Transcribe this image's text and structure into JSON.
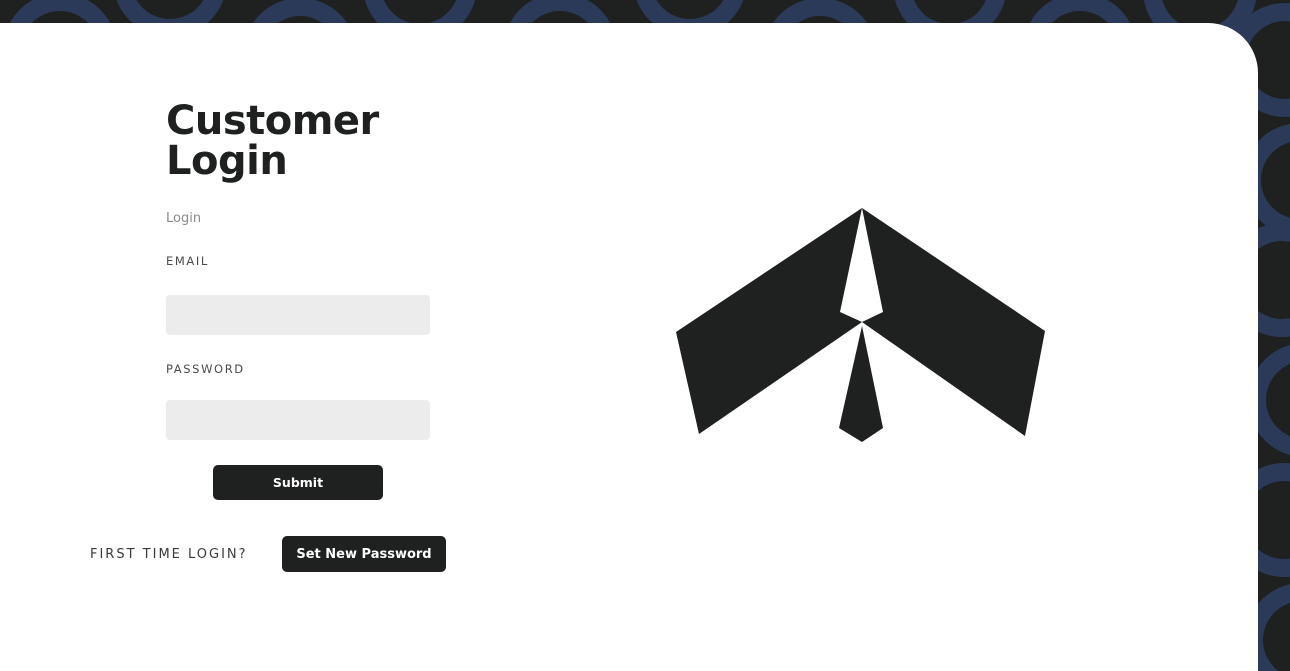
{
  "login": {
    "title_line1": "Customer",
    "title_line2": "Login",
    "subtitle": "Login",
    "email_label": "EMAIL",
    "email_value": "",
    "password_label": "PASSWORD",
    "password_value": "",
    "submit_label": "Submit",
    "first_time_text": "FIRST TIME LOGIN?",
    "set_password_label": "Set New Password"
  },
  "logo": {
    "icon": "arrow-tie-logo",
    "color": "#1e2120"
  },
  "colors": {
    "dark": "#1e2120",
    "pattern_accent": "#2c3a5a",
    "card": "#ffffff",
    "field_bg": "#ececec"
  }
}
